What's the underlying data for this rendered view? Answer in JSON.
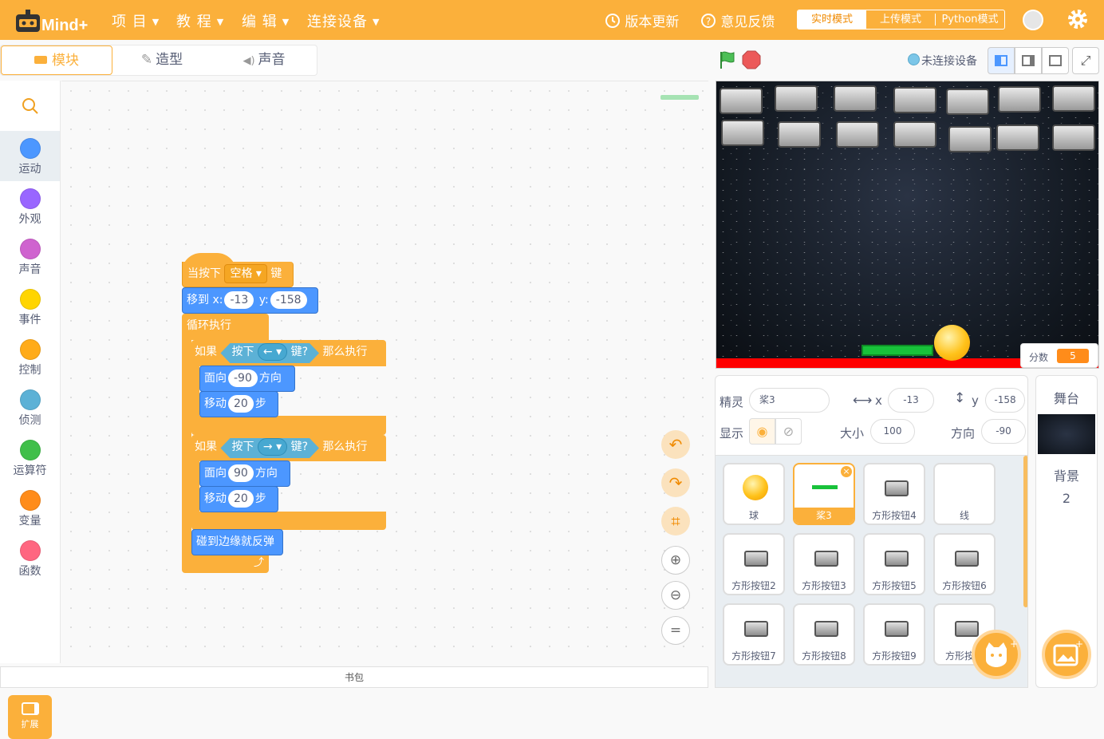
{
  "app": {
    "logo_text": "Mind+"
  },
  "menu": {
    "project": "项 目",
    "tutorial": "教 程",
    "edit": "编 辑",
    "connect": "连接设备"
  },
  "topright": {
    "update": "版本更新",
    "feedback": "意见反馈"
  },
  "modes": {
    "realtime": "实时模式",
    "upload": "上传模式",
    "python": "Python模式"
  },
  "tabs": {
    "blocks": "模块",
    "costumes": "造型",
    "sounds": "声音"
  },
  "categories": [
    {
      "label": "运动",
      "color": "#4c97ff"
    },
    {
      "label": "外观",
      "color": "#9966ff"
    },
    {
      "label": "声音",
      "color": "#cf63cf"
    },
    {
      "label": "事件",
      "color": "#ffd500"
    },
    {
      "label": "控制",
      "color": "#ffab19"
    },
    {
      "label": "侦测",
      "color": "#5cb1d6"
    },
    {
      "label": "运算符",
      "color": "#40bf4a"
    },
    {
      "label": "变量",
      "color": "#ff8c1a"
    },
    {
      "label": "函数",
      "color": "#ff6680"
    }
  ],
  "extension": {
    "label": "扩展"
  },
  "backpack": {
    "label": "书包"
  },
  "script": {
    "hat": {
      "prefix": "当按下",
      "key": "空格",
      "suffix": "键"
    },
    "goto": {
      "label": "移到 x:",
      "x": "-13",
      "ylabel": "y:",
      "y": "-158"
    },
    "forever": {
      "label": "循环执行"
    },
    "if1": {
      "if": "如果",
      "press": "按下",
      "key": "←",
      "keysuffix": "键?",
      "then": "那么执行"
    },
    "face1": {
      "label": "面向",
      "value": "-90",
      "suffix": "方向"
    },
    "move1": {
      "label": "移动",
      "value": "20",
      "suffix": "步"
    },
    "if2": {
      "if": "如果",
      "press": "按下",
      "key": "→",
      "keysuffix": "键?",
      "then": "那么执行"
    },
    "face2": {
      "label": "面向",
      "value": "90",
      "suffix": "方向"
    },
    "move2": {
      "label": "移动",
      "value": "20",
      "suffix": "步"
    },
    "bounce": {
      "label": "碰到边缘就反弹"
    }
  },
  "stage": {
    "connection": "未连接设备",
    "score_label": "分数",
    "score_value": "5"
  },
  "sprite_info": {
    "sprite_label": "精灵",
    "sprite_name": "桨3",
    "x_label": "x",
    "x_value": "-13",
    "y_label": "y",
    "y_value": "-158",
    "show_label": "显示",
    "size_label": "大小",
    "size_value": "100",
    "direction_label": "方向",
    "direction_value": "-90"
  },
  "sprites": [
    "球",
    "桨3",
    "方形按钮4",
    "线",
    "方形按钮2",
    "方形按钮3",
    "方形按钮5",
    "方形按钮6",
    "方形按钮7",
    "方形按钮8",
    "方形按钮9",
    "方形按钮"
  ],
  "backdrop": {
    "title": "舞台",
    "label": "背景",
    "count": "2"
  }
}
